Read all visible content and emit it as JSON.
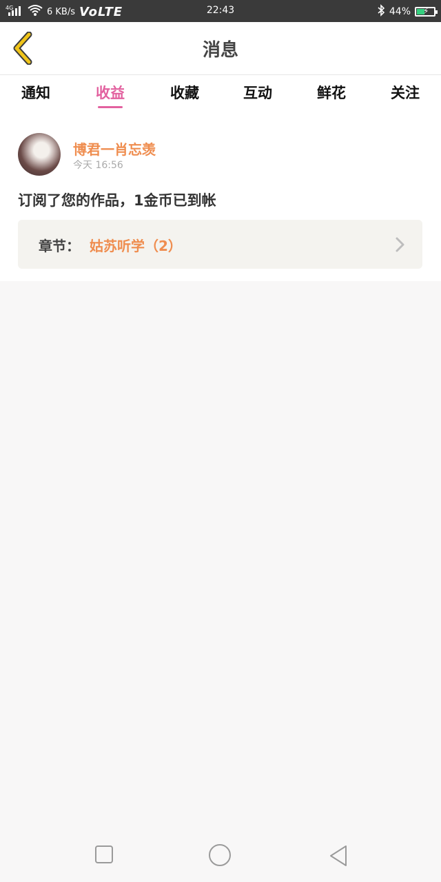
{
  "status_bar": {
    "network": "4G",
    "speed": "6 KB/s",
    "volte": "VoLTE",
    "time": "22:43",
    "battery": "44%",
    "battery_level": 0.44
  },
  "header": {
    "title": "消息",
    "back_icon": "chevron-left-icon"
  },
  "tabs": [
    {
      "label": "通知",
      "active": false
    },
    {
      "label": "收益",
      "active": true
    },
    {
      "label": "收藏",
      "active": false
    },
    {
      "label": "互动",
      "active": false
    },
    {
      "label": "鲜花",
      "active": false
    },
    {
      "label": "关注",
      "active": false
    }
  ],
  "message": {
    "username": "博君一肖忘羡",
    "time": "今天 16:56",
    "text": "订阅了您的作品，1金币已到帐",
    "chapter_label": "章节：",
    "chapter_name": "姑苏听学（2）"
  },
  "colors": {
    "accent": "#e2619f",
    "username": "#ef8d4f",
    "back": "#f0c419"
  }
}
